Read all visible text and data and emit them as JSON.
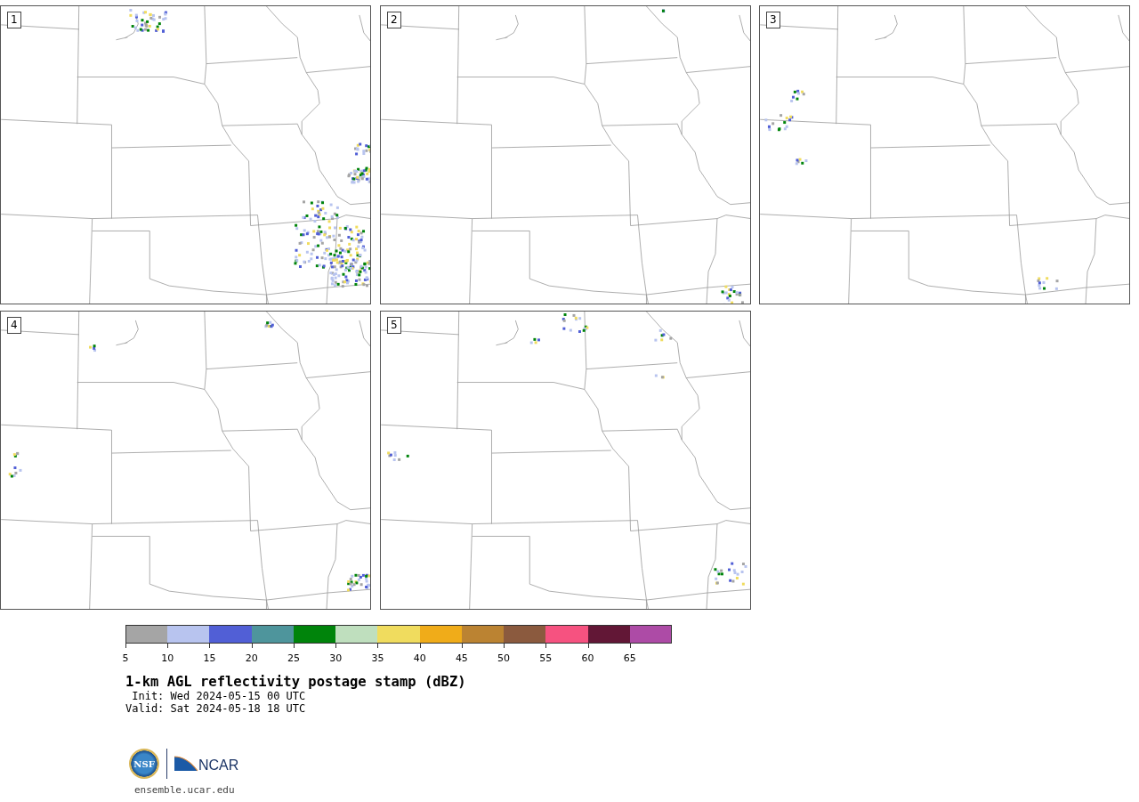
{
  "panels": [
    {
      "number": "1"
    },
    {
      "number": "2"
    },
    {
      "number": "3"
    },
    {
      "number": "4"
    },
    {
      "number": "5"
    }
  ],
  "colorbar": {
    "segments": [
      {
        "color": "#a5a5a5",
        "tick": "5"
      },
      {
        "color": "#b8c4ef",
        "tick": "10"
      },
      {
        "color": "#515fd6",
        "tick": "15"
      },
      {
        "color": "#4e959c",
        "tick": "20"
      },
      {
        "color": "#00840b",
        "tick": "25"
      },
      {
        "color": "#bfdfbe",
        "tick": "30"
      },
      {
        "color": "#f0dc5e",
        "tick": "35"
      },
      {
        "color": "#f0ac19",
        "tick": "40"
      },
      {
        "color": "#bb8332",
        "tick": "45"
      },
      {
        "color": "#8b5a3e",
        "tick": "50"
      },
      {
        "color": "#f65280",
        "tick": "55"
      },
      {
        "color": "#621736",
        "tick": "60"
      },
      {
        "color": "#ad4ba6",
        "tick": "65"
      }
    ]
  },
  "title": "1-km AGL reflectivity postage stamp (dBZ)",
  "init": " Init: Wed 2024-05-15 00 UTC",
  "valid": "Valid: Sat 2024-05-18 18 UTC",
  "logos": {
    "nsf": "NSF",
    "ncar": "NCAR"
  },
  "url": "ensemble.ucar.edu"
}
